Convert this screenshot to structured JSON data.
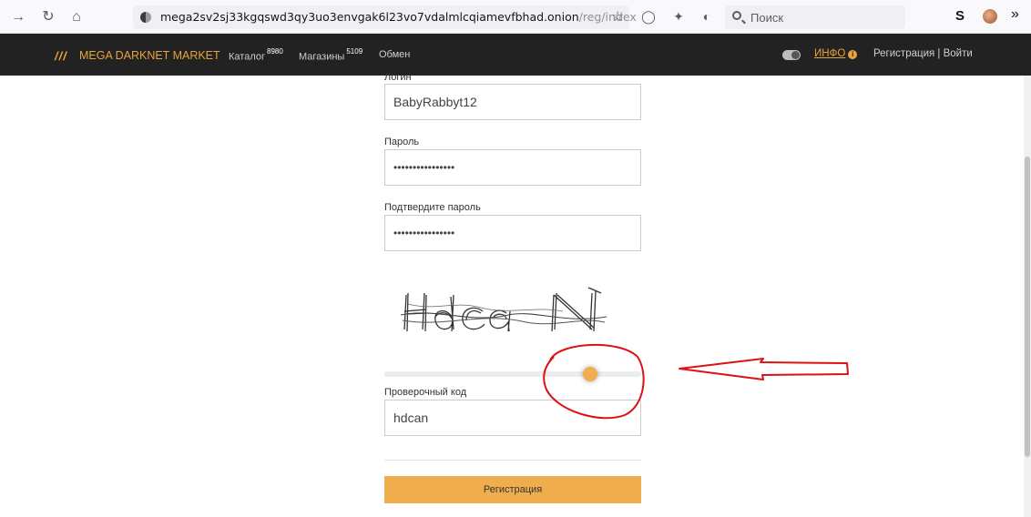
{
  "browser": {
    "url_host": "mega2sv2sj33kgqswd3qy3uo3envgak6l23vo7vdalmlcqiamevfbhad.onion",
    "url_path": "/reg/index",
    "search_placeholder": "Поиск",
    "extension_label": "S",
    "icons": [
      "back-arrow-icon",
      "reload-icon",
      "home-icon",
      "site-identity-icon",
      "bookmark-star-icon",
      "shield-icon",
      "extension-icon",
      "tracker-icon",
      "search-icon",
      "overflow-menu-icon"
    ]
  },
  "nav": {
    "brand_slashes": "///",
    "brand_name": "MEGA DARKNET MARKET",
    "catalog_label": "Каталог",
    "catalog_count": "8980",
    "shops_label": "Магазины",
    "shops_count": "5109",
    "exchange_label": "Обмен",
    "info_label": "ИНФО",
    "auth_label": "Регистрация | Войти",
    "accent_color": "#e8a33a",
    "bar_color": "#222222"
  },
  "form": {
    "login_label": "Логин",
    "login_value": "BabyRabbyt12",
    "password_label": "Пароль",
    "password_value": "••••••••••••••••",
    "confirm_label": "Подтвердите пароль",
    "confirm_value": "••••••••••••••••",
    "captcha_text": "HdcaN",
    "slider_value": 0.82,
    "code_label": "Проверочный код",
    "code_value": "hdcan",
    "submit_label": "Регистрация",
    "button_color": "#f0ad4e"
  }
}
